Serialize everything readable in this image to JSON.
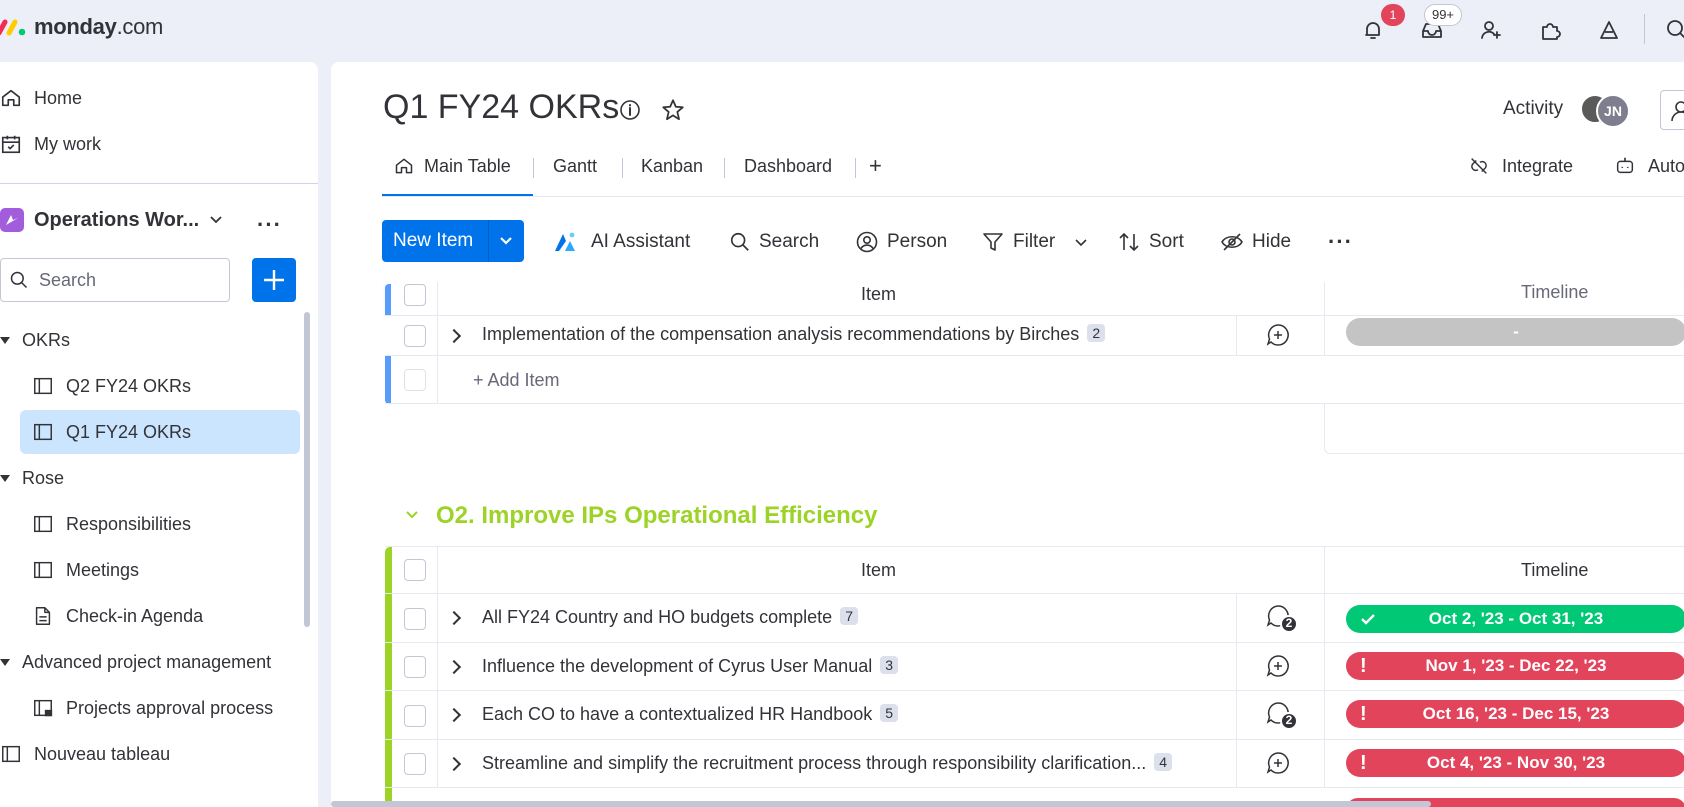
{
  "app": {
    "logo": "monday",
    "logo_suffix": ".com",
    "notifications_count": "1",
    "inbox_count": "99+"
  },
  "sidebar": {
    "home": "Home",
    "my_work": "My work",
    "workspace": "Operations Wor...",
    "search_placeholder": "Search",
    "folders": [
      {
        "label": "OKRs"
      },
      {
        "label": "Q2 FY24 OKRs"
      },
      {
        "label": "Q1 FY24 OKRs"
      },
      {
        "label": "Rose"
      },
      {
        "label": "Responsibilities"
      },
      {
        "label": "Meetings"
      },
      {
        "label": "Check-in Agenda"
      },
      {
        "label": "Advanced project management"
      },
      {
        "label": "Projects approval process"
      },
      {
        "label": "Nouveau tableau"
      }
    ]
  },
  "board": {
    "title": "Q1 FY24 OKRs",
    "activity": "Activity",
    "avatar_initials": "JN",
    "tabs": [
      "Main Table",
      "Gantt",
      "Kanban",
      "Dashboard",
      "+"
    ],
    "integrate": "Integrate",
    "automate": "Auto"
  },
  "toolbar": {
    "new_item": "New Item",
    "ai_assistant": "AI Assistant",
    "search": "Search",
    "person": "Person",
    "filter": "Filter",
    "sort": "Sort",
    "hide": "Hide"
  },
  "group1": {
    "col_item": "Item",
    "col_timeline": "Timeline",
    "rows": [
      {
        "name": "Implementation of the compensation analysis recommendations by Birches",
        "count": "2",
        "timeline": "-"
      }
    ],
    "add_item": "+ Add Item"
  },
  "group2": {
    "title": "O2. Improve IPs Operational Efficiency",
    "color": "#9cd326",
    "col_item": "Item",
    "col_timeline": "Timeline",
    "rows": [
      {
        "name": "All FY24 Country and HO budgets complete",
        "count": "7",
        "updates": "2",
        "timeline": "Oct 2, '23 - Oct 31, '23",
        "status": "done"
      },
      {
        "name": "Influence the development of Cyrus User Manual",
        "count": "3",
        "updates": "",
        "timeline": "Nov 1, '23 - Dec 22, '23",
        "status": "overdue"
      },
      {
        "name": "Each CO to have a contextualized HR Handbook",
        "count": "5",
        "updates": "2",
        "timeline": "Oct 16, '23 - Dec 15, '23",
        "status": "overdue"
      },
      {
        "name": "Streamline and simplify the recruitment process through responsibility clarification...",
        "count": "4",
        "updates": "",
        "timeline": "Oct 4, '23 - Nov 30, '23",
        "status": "overdue"
      }
    ]
  },
  "colors": {
    "primary": "#0073ea",
    "done": "#00c875",
    "overdue": "#e2445c",
    "empty": "#c4c4c4",
    "group1": "#579bfc"
  }
}
